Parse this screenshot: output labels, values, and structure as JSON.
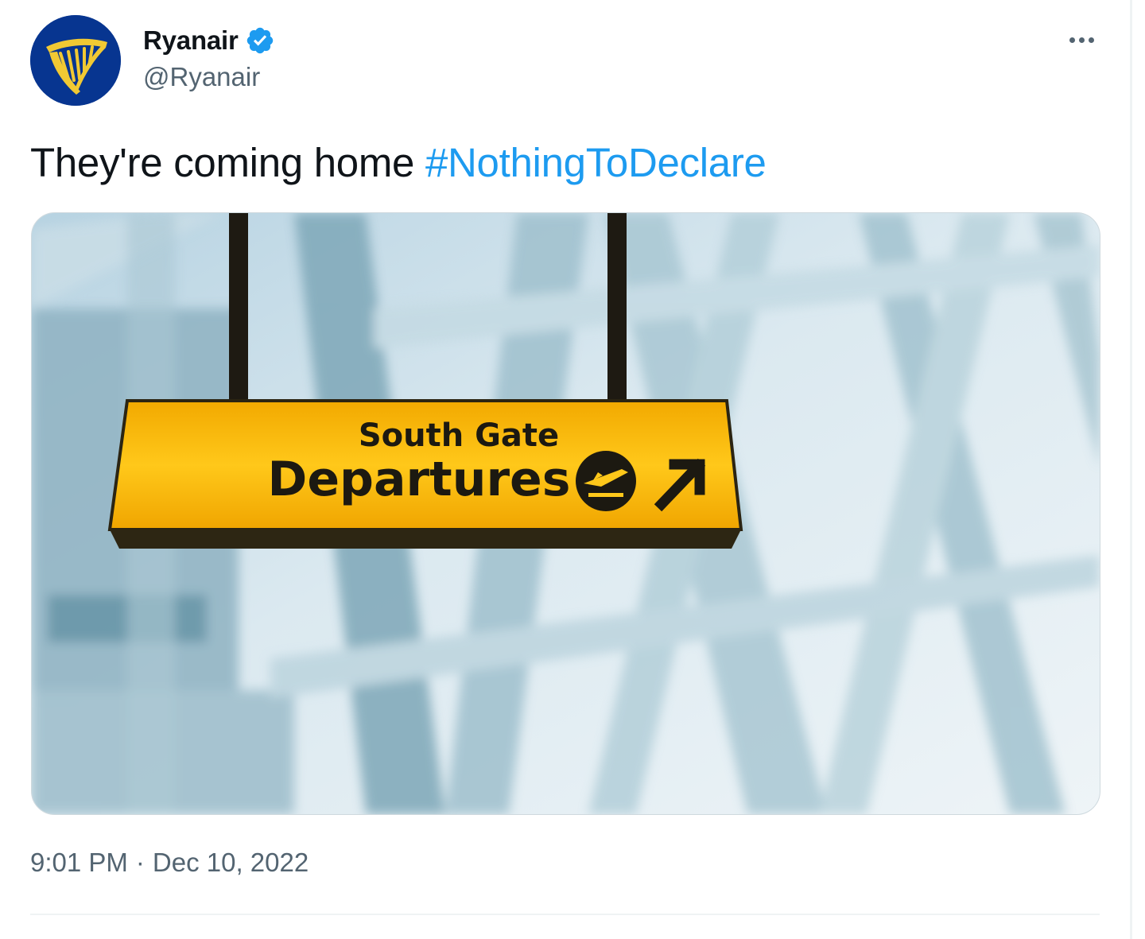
{
  "author": {
    "display_name": "Ryanair",
    "handle": "@Ryanair",
    "verified": true,
    "avatar_icon": "ryanair-harp-logo",
    "avatar_color": "#073590",
    "logo_color": "#f1c933"
  },
  "menu": {
    "more_icon": "more-horizontal-icon"
  },
  "tweet": {
    "text": "They're coming home ",
    "hashtag": "#NothingToDeclare",
    "hashtag_color": "#1d9bf0"
  },
  "media": {
    "sign": {
      "line1": "South Gate",
      "line2": "Departures",
      "icons": [
        "plane-departure-icon",
        "arrow-up-right-icon"
      ],
      "sign_color": "#f7b900"
    }
  },
  "meta": {
    "time": "9:01 PM",
    "separator": "·",
    "date": "Dec 10, 2022"
  },
  "colors": {
    "text": "#0f1419",
    "secondary": "#536471",
    "verified_badge": "#1d9bf0"
  }
}
